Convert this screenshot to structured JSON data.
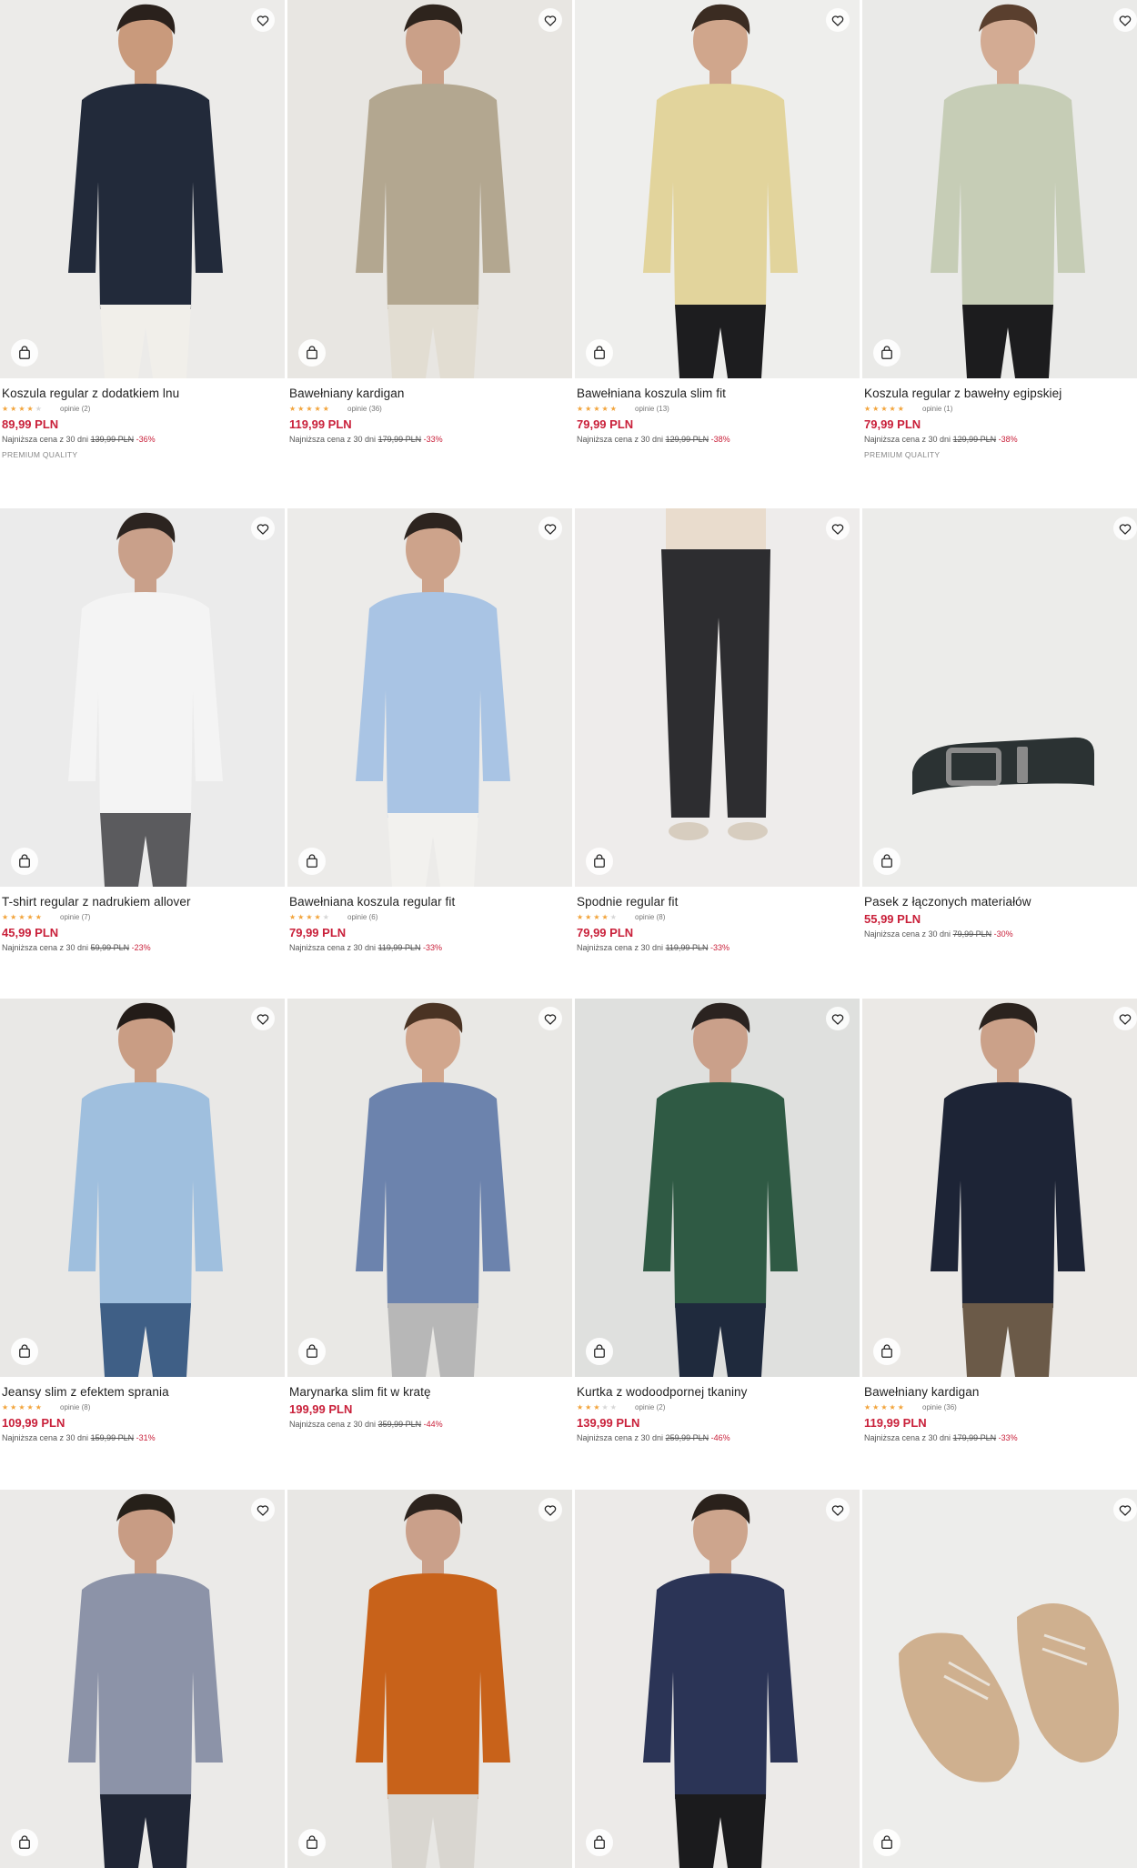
{
  "lowest_prefix": "Najniższa cena z 30 dni",
  "products": [
    {
      "name": "Koszula regular z dodatkiem lnu",
      "stars": 4,
      "reviews": "opinie (2)",
      "price": "89,99 PLN",
      "old_price": "139,99 PLN",
      "discount": "-36%",
      "badge": "PREMIUM QUALITY",
      "colors": {
        "bg": "#ecebe9",
        "top": "#222a3a",
        "bottom": "#f1efea",
        "skin": "#c99a7c",
        "hair": "#2a211c"
      },
      "kind": "person"
    },
    {
      "name": "Bawełniany kardigan",
      "stars": 5,
      "reviews": "opinie (36)",
      "price": "119,99 PLN",
      "old_price": "179,99 PLN",
      "discount": "-33%",
      "badge": "",
      "colors": {
        "bg": "#e8e6e2",
        "top": "#b3a790",
        "bottom": "#e2ddd2",
        "skin": "#caa088",
        "hair": "#2e241d"
      },
      "kind": "person"
    },
    {
      "name": "Bawełniana koszula slim fit",
      "stars": 5,
      "reviews": "opinie (13)",
      "price": "79,99 PLN",
      "old_price": "129,99 PLN",
      "discount": "-38%",
      "badge": "",
      "colors": {
        "bg": "#eeeeec",
        "top": "#e2d49c",
        "bottom": "#1d1d1f",
        "skin": "#d0a68c",
        "hair": "#3b2c22"
      },
      "kind": "person"
    },
    {
      "name": "Koszula regular z bawełny egipskiej",
      "stars": 5,
      "reviews": "opinie (1)",
      "price": "79,99 PLN",
      "old_price": "129,99 PLN",
      "discount": "-38%",
      "badge": "PREMIUM QUALITY",
      "colors": {
        "bg": "#eaeae8",
        "top": "#c6cdb6",
        "bottom": "#1c1c1e",
        "skin": "#d3ab93",
        "hair": "#5a3f2e"
      },
      "kind": "person"
    },
    {
      "name": "T-shirt regular z nadrukiem allover",
      "stars": 5,
      "reviews": "opinie (7)",
      "price": "45,99 PLN",
      "old_price": "59,99 PLN",
      "discount": "-23%",
      "badge": "",
      "colors": {
        "bg": "#ebebeb",
        "top": "#f4f4f4",
        "bottom": "#5b5b5e",
        "skin": "#c9a08a",
        "hair": "#2c2420"
      },
      "kind": "person"
    },
    {
      "name": "Bawełniana koszula regular fit",
      "stars": 4,
      "reviews": "opinie (6)",
      "price": "79,99 PLN",
      "old_price": "119,99 PLN",
      "discount": "-33%",
      "badge": "",
      "colors": {
        "bg": "#ecebe9",
        "top": "#a9c4e4",
        "bottom": "#f2f1ee",
        "skin": "#cda38b",
        "hair": "#2d241f"
      },
      "kind": "person"
    },
    {
      "name": "Spodnie regular fit",
      "stars": 4,
      "reviews": "opinie (8)",
      "price": "79,99 PLN",
      "old_price": "119,99 PLN",
      "discount": "-33%",
      "badge": "",
      "colors": {
        "bg": "#eeeceb",
        "top": "#e9dccd",
        "bottom": "#2d2d30",
        "skin": "#d2aa92",
        "hair": "#2d241f"
      },
      "kind": "pants"
    },
    {
      "name": "Pasek z łączonych materiałów",
      "stars": 0,
      "reviews": "",
      "price": "55,99 PLN",
      "old_price": "79,99 PLN",
      "discount": "-30%",
      "badge": "",
      "colors": {
        "bg": "#ececea",
        "top": "#2b3233",
        "bottom": "#8a8a8a",
        "skin": "#000000",
        "hair": "#000000"
      },
      "kind": "belt"
    },
    {
      "name": "Jeansy slim z efektem sprania",
      "stars": 5,
      "reviews": "opinie (8)",
      "price": "109,99 PLN",
      "old_price": "159,99 PLN",
      "discount": "-31%",
      "badge": "",
      "colors": {
        "bg": "#e9e8e6",
        "top": "#9fbfde",
        "bottom": "#3f5f86",
        "skin": "#c99d84",
        "hair": "#231c18"
      },
      "kind": "person"
    },
    {
      "name": "Marynarka slim fit w kratę",
      "stars": 0,
      "reviews": "",
      "price": "199,99 PLN",
      "old_price": "359,99 PLN",
      "discount": "-44%",
      "badge": "",
      "colors": {
        "bg": "#e9e8e5",
        "top": "#6c83ad",
        "bottom": "#b7b7b7",
        "skin": "#d1a68d",
        "hair": "#4a3323"
      },
      "kind": "person"
    },
    {
      "name": "Kurtka z wodoodpornej tkaniny",
      "stars": 3,
      "reviews": "opinie (2)",
      "price": "139,99 PLN",
      "old_price": "259,99 PLN",
      "discount": "-46%",
      "badge": "",
      "colors": {
        "bg": "#dfe0de",
        "top": "#2f5a44",
        "bottom": "#1f2a3d",
        "skin": "#caa08a",
        "hair": "#2b2320"
      },
      "kind": "person"
    },
    {
      "name": "Bawełniany kardigan",
      "stars": 5,
      "reviews": "opinie (36)",
      "price": "119,99 PLN",
      "old_price": "179,99 PLN",
      "discount": "-33%",
      "badge": "",
      "colors": {
        "bg": "#ebe9e6",
        "top": "#1d2436",
        "bottom": "#6b5a48",
        "skin": "#cba189",
        "hair": "#2b231e"
      },
      "kind": "person"
    },
    {
      "name": "",
      "stars": 0,
      "reviews": "",
      "price": "",
      "old_price": "",
      "discount": "",
      "badge": "",
      "colors": {
        "bg": "#ebeae8",
        "top": "#8c93a8",
        "bottom": "#202636",
        "skin": "#c89c84",
        "hair": "#262019"
      },
      "kind": "person"
    },
    {
      "name": "",
      "stars": 0,
      "reviews": "",
      "price": "",
      "old_price": "",
      "discount": "",
      "badge": "",
      "colors": {
        "bg": "#e8e7e4",
        "top": "#c8621a",
        "bottom": "#d9d6d0",
        "skin": "#caa08a",
        "hair": "#2c231d"
      },
      "kind": "person"
    },
    {
      "name": "",
      "stars": 0,
      "reviews": "",
      "price": "",
      "old_price": "",
      "discount": "",
      "badge": "",
      "colors": {
        "bg": "#eceae8",
        "top": "#2b3456",
        "bottom": "#1b1b1d",
        "skin": "#cda58d",
        "hair": "#2a211b"
      },
      "kind": "person"
    },
    {
      "name": "",
      "stars": 0,
      "reviews": "",
      "price": "",
      "old_price": "",
      "discount": "",
      "badge": "",
      "colors": {
        "bg": "#ededeb",
        "top": "#cfb08f",
        "bottom": "#e9e2d8",
        "skin": "#000000",
        "hair": "#000000"
      },
      "kind": "shoes"
    }
  ]
}
